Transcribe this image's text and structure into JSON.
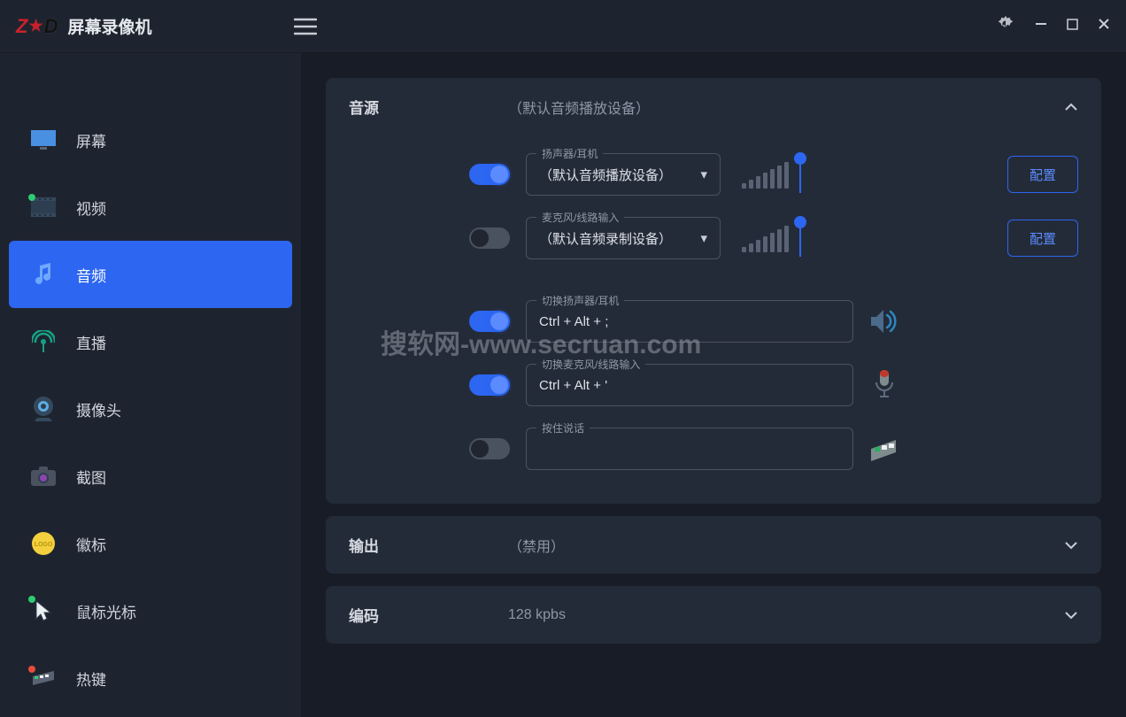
{
  "app": {
    "title": "屏幕录像机"
  },
  "sidebar": {
    "items": [
      {
        "label": "屏幕"
      },
      {
        "label": "视频"
      },
      {
        "label": "音频"
      },
      {
        "label": "直播"
      },
      {
        "label": "摄像头"
      },
      {
        "label": "截图"
      },
      {
        "label": "徽标"
      },
      {
        "label": "鼠标光标"
      },
      {
        "label": "热键"
      }
    ]
  },
  "watermark": "搜软网-www.secruan.com",
  "panels": {
    "source": {
      "label": "音源",
      "value": "（默认音频播放设备）",
      "speaker": {
        "label": "扬声器/耳机",
        "selected": "（默认音频播放设备）",
        "configure": "配置"
      },
      "mic": {
        "label": "麦克风/线路输入",
        "selected": "（默认音频录制设备）",
        "configure": "配置"
      },
      "hk_speaker": {
        "label": "切换扬声器/耳机",
        "value": "Ctrl + Alt + ;"
      },
      "hk_mic": {
        "label": "切换麦克风/线路输入",
        "value": "Ctrl + Alt + '"
      },
      "hk_ptt": {
        "label": "按住说话",
        "value": ""
      }
    },
    "output": {
      "label": "输出",
      "value": "（禁用）"
    },
    "encode": {
      "label": "编码",
      "value": "128 kpbs"
    }
  }
}
